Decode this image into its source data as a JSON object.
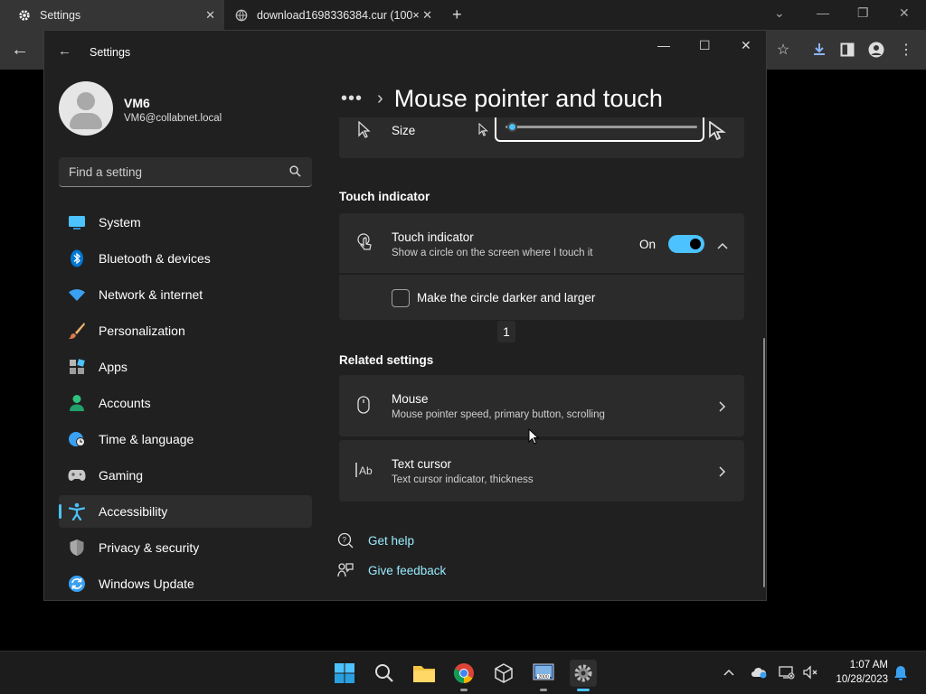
{
  "browser": {
    "tabs": [
      {
        "title": "Settings"
      },
      {
        "title": "download1698336384.cur (100×"
      }
    ]
  },
  "window": {
    "title": "Settings"
  },
  "user": {
    "name": "VM6",
    "email": "VM6@collabnet.local"
  },
  "search": {
    "placeholder": "Find a setting"
  },
  "sidebar": {
    "items": [
      {
        "label": "System",
        "icon": "system-icon"
      },
      {
        "label": "Bluetooth & devices",
        "icon": "bluetooth-icon"
      },
      {
        "label": "Network & internet",
        "icon": "wifi-icon"
      },
      {
        "label": "Personalization",
        "icon": "brush-icon"
      },
      {
        "label": "Apps",
        "icon": "apps-icon"
      },
      {
        "label": "Accounts",
        "icon": "accounts-icon"
      },
      {
        "label": "Time & language",
        "icon": "globe-clock-icon"
      },
      {
        "label": "Gaming",
        "icon": "gamepad-icon"
      },
      {
        "label": "Accessibility",
        "icon": "accessibility-icon",
        "active": true
      },
      {
        "label": "Privacy & security",
        "icon": "shield-icon"
      },
      {
        "label": "Windows Update",
        "icon": "update-icon"
      }
    ]
  },
  "header": {
    "breadcrumb_more": "•••",
    "title": "Mouse pointer and touch"
  },
  "size_row": {
    "label": "Size",
    "slider_value_fraction": 0.02
  },
  "touch_section": {
    "heading": "Touch indicator",
    "row_title": "Touch indicator",
    "row_subtitle": "Show a circle on the screen where I touch it",
    "toggle_label": "On",
    "toggle_on": true,
    "checkbox_label": "Make the circle darker and larger",
    "badge": "1"
  },
  "related": {
    "heading": "Related settings",
    "items": [
      {
        "title": "Mouse",
        "subtitle": "Mouse pointer speed, primary button, scrolling"
      },
      {
        "title": "Text cursor",
        "subtitle": "Text cursor indicator, thickness"
      }
    ]
  },
  "links": {
    "help": "Get help",
    "feedback": "Give feedback"
  },
  "taskbar": {
    "time": "1:07 AM",
    "date": "10/28/2023"
  },
  "colors": {
    "accent": "#4cc2ff",
    "link": "#99ebff",
    "window_bg": "#202020",
    "card_bg": "#2b2b2b"
  }
}
